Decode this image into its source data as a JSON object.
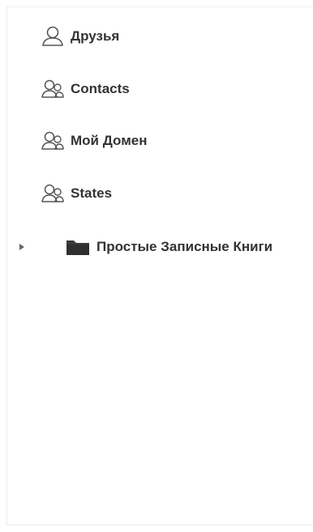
{
  "tree": {
    "items": [
      {
        "label": "Друзья",
        "icon": "person-icon"
      },
      {
        "label": "Contacts",
        "icon": "people-icon"
      },
      {
        "label": "Мой Домен",
        "icon": "people-icon"
      },
      {
        "label": "States",
        "icon": "people-icon"
      }
    ],
    "folder": {
      "label": "Простые Записные Книги",
      "icon": "folder-icon",
      "expander_icon": "triangle-right-icon",
      "expanded": false
    }
  },
  "colors": {
    "text": "#333333",
    "icon_stroke": "#555555",
    "folder": "#3a3a3a",
    "border": "#ececec"
  }
}
